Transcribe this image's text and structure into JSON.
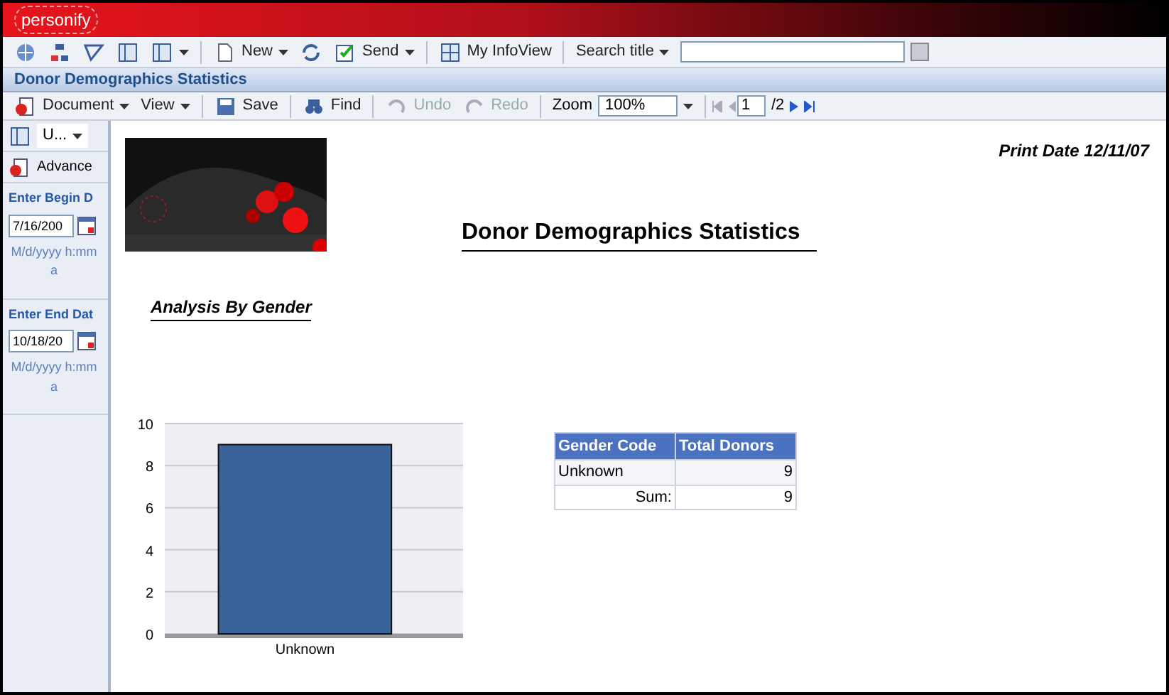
{
  "app": {
    "logo": "personify"
  },
  "toolbar": {
    "items": [
      {
        "kind": "icon"
      },
      {
        "kind": "icon"
      },
      {
        "kind": "icon"
      },
      {
        "kind": "icon"
      },
      {
        "kind": "menu-icon"
      },
      {
        "kind": "menu",
        "label": "New"
      },
      {
        "kind": "icon"
      },
      {
        "kind": "menu",
        "label": "Send"
      },
      {
        "kind": "button",
        "label": "My InfoView"
      },
      {
        "kind": "menu",
        "label": "Search title"
      }
    ]
  },
  "document": {
    "title": "Donor Demographics Statistics"
  },
  "doc_toolbar": {
    "items": [
      {
        "kind": "menu",
        "label": "Document",
        "disabled": false
      },
      {
        "kind": "menu",
        "label": "View",
        "disabled": false
      },
      {
        "kind": "button",
        "label": "Save",
        "disabled": false
      },
      {
        "kind": "button",
        "label": "Find",
        "disabled": false
      },
      {
        "kind": "button",
        "label": "Undo",
        "disabled": true
      },
      {
        "kind": "button",
        "label": "Redo",
        "disabled": true
      }
    ],
    "zoom_label": "Zoom",
    "zoom": "100%",
    "page": "1",
    "page_total": "/2"
  },
  "sidebar": {
    "dropdown": "U...",
    "advanced": "Advance",
    "fields": [
      {
        "label": "Enter Begin D",
        "value": "7/16/200",
        "hint": "M/d/yyyy h:mm a"
      },
      {
        "label": "Enter End Dat",
        "value": "10/18/20",
        "hint": "M/d/yyyy h:mm a"
      }
    ]
  },
  "report": {
    "print_date": "Print Date 12/11/07",
    "title": "Donor Demographics Statistics",
    "section": "Analysis By Gender",
    "chart_data": {
      "type": "bar",
      "categories": [
        "Unknown"
      ],
      "series": [
        {
          "color": "#3a6499",
          "values": [
            9
          ]
        }
      ],
      "ylim": [
        0,
        10
      ],
      "yticks": [
        0,
        2,
        4,
        6,
        8,
        10
      ],
      "grid": true
    },
    "table": {
      "columns": [
        "Gender Code",
        "Total Donors"
      ],
      "rows": [
        {
          "kind": "data",
          "cells": [
            "Unknown",
            "9"
          ]
        },
        {
          "kind": "sum",
          "cells": [
            "Sum:",
            "9"
          ]
        }
      ]
    }
  }
}
